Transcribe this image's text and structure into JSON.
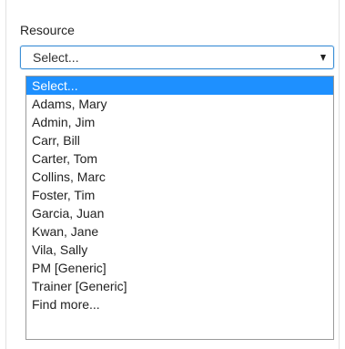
{
  "field": {
    "label": "Resource",
    "selected_value": "Select..."
  },
  "dropdown": {
    "selected_index": 0,
    "options": [
      "Select...",
      "Adams, Mary",
      "Admin, Jim",
      "Carr, Bill",
      "Carter, Tom",
      "Collins, Marc",
      "Foster, Tim",
      "Garcia, Juan",
      "Kwan, Jane",
      "Vila, Sally",
      "PM [Generic]",
      "Trainer [Generic]",
      "Find more..."
    ]
  },
  "colors": {
    "highlight": "#1E90FF",
    "focus_border": "#3C8FD6"
  }
}
